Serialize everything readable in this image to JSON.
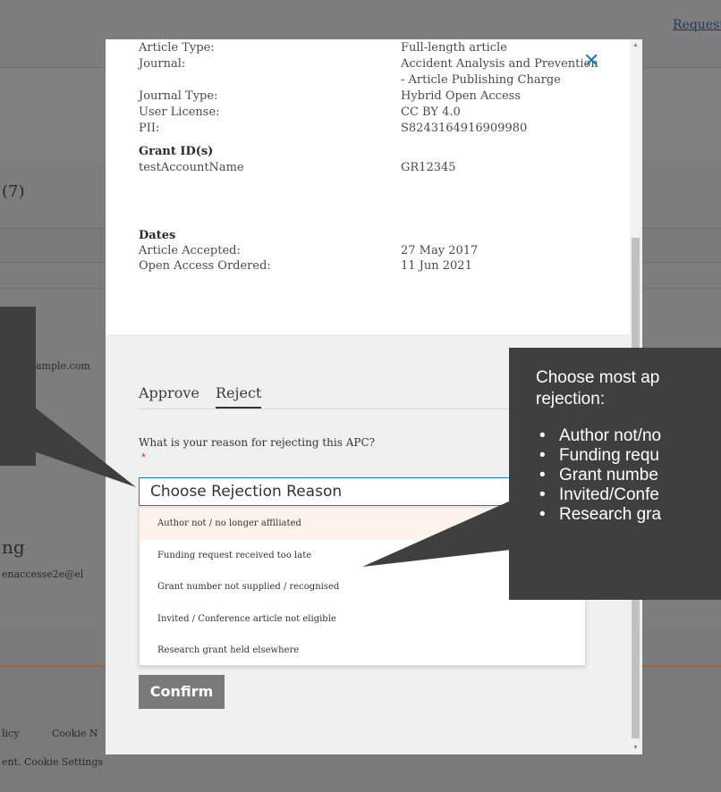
{
  "background": {
    "top_link": "Request",
    "count_text": "(7)",
    "email_text": "ample.com",
    "heading_text": "ng",
    "email2_text": "enaccesse2e@el",
    "footer_links": [
      "licy",
      "Cookie N"
    ],
    "footer_text": "ent. Cookie Settings"
  },
  "details": {
    "article_type_label": "Article Type:",
    "article_type_value": "Full-length article",
    "journal_label": "Journal:",
    "journal_value_line1": "Accident Analysis and Prevention",
    "journal_value_line2": "- Article Publishing Charge",
    "journal_type_label": "Journal Type:",
    "journal_type_value": "Hybrid Open Access",
    "user_license_label": "User License:",
    "user_license_value": "CC BY 4.0",
    "pii_label": "PII:",
    "pii_value": "S8243164916909980",
    "grant_heading": "Grant ID(s)",
    "grant_account": "testAccountName",
    "grant_id": "GR12345",
    "dates_heading": "Dates",
    "accepted_label": "Article Accepted:",
    "accepted_value": "27 May 2017",
    "oa_ordered_label": "Open Access Ordered:",
    "oa_ordered_value": "11 Jun 2021",
    "close_symbol": "✕"
  },
  "action": {
    "tab_approve": "Approve",
    "tab_reject": "Reject",
    "question": "What is your reason for rejecting this APC?",
    "required_marker": "*",
    "select_placeholder": "Choose Rejection Reason",
    "options": [
      "Author not / no longer affiliated",
      "Funding request received too late",
      "Grant number not supplied / recognised",
      "Invited / Conference article not eligible",
      "Research grant held elsewhere"
    ],
    "confirm_label": "Confirm"
  },
  "callout": {
    "lead_line1": "Choose most ap",
    "lead_line2": "rejection:",
    "bullets": [
      "Author not/no",
      "Funding requ",
      "Grant numbe",
      "Invited/Confe",
      "Research gra"
    ]
  },
  "colors": {
    "accent": "#1a7fb5",
    "callout_bg": "#3f3f3f",
    "confirm_bg": "#7a7a7a",
    "highlight_option": "#fdf3ec"
  }
}
